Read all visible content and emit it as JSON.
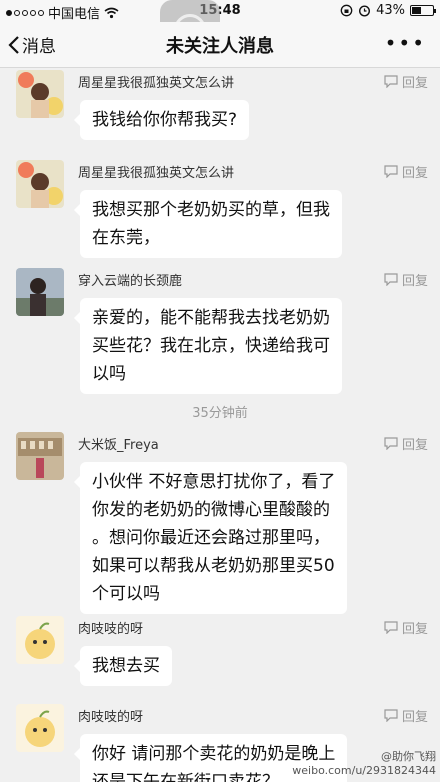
{
  "status_bar": {
    "carrier": "中国电信",
    "time": "15:48",
    "battery": "43%",
    "battery_level": 0.43
  },
  "nav": {
    "back_label": "消息",
    "title": "未关注人消息",
    "more": "•••"
  },
  "reply_label": "回复",
  "messages": [
    {
      "sender": "周星星我很孤独英文怎么讲",
      "lines": [
        "我钱给你你帮我买?"
      ]
    },
    {
      "sender": "周星星我很孤独英文怎么讲",
      "lines": [
        "我想买那个老奶奶买的草，但我",
        "在东莞，"
      ]
    },
    {
      "sender": "穿入云端的长颈鹿",
      "lines": [
        "亲爱的，能不能帮我去找老奶奶",
        "买些花？我在北京，快递给我可",
        "以吗"
      ]
    },
    {
      "sender": "大米饭_Freya",
      "lines": [
        "小伙伴 不好意思打扰你了，看了",
        "你发的老奶奶的微博心里酸酸的",
        "。想问你最近还会路过那里吗，",
        "如果可以帮我从老奶奶那里买50",
        "个可以吗"
      ]
    },
    {
      "sender": "肉吱吱的呀",
      "lines": [
        "我想去买"
      ]
    },
    {
      "sender": "肉吱吱的呀",
      "lines": [
        "你好 请问那个卖花的奶奶是晚上",
        "还是下午在新街口卖花？"
      ]
    }
  ],
  "time_separator": "35分钟前",
  "watermark": {
    "line1": "@助你飞翔",
    "line2": "weibo.com/u/2931824344"
  }
}
